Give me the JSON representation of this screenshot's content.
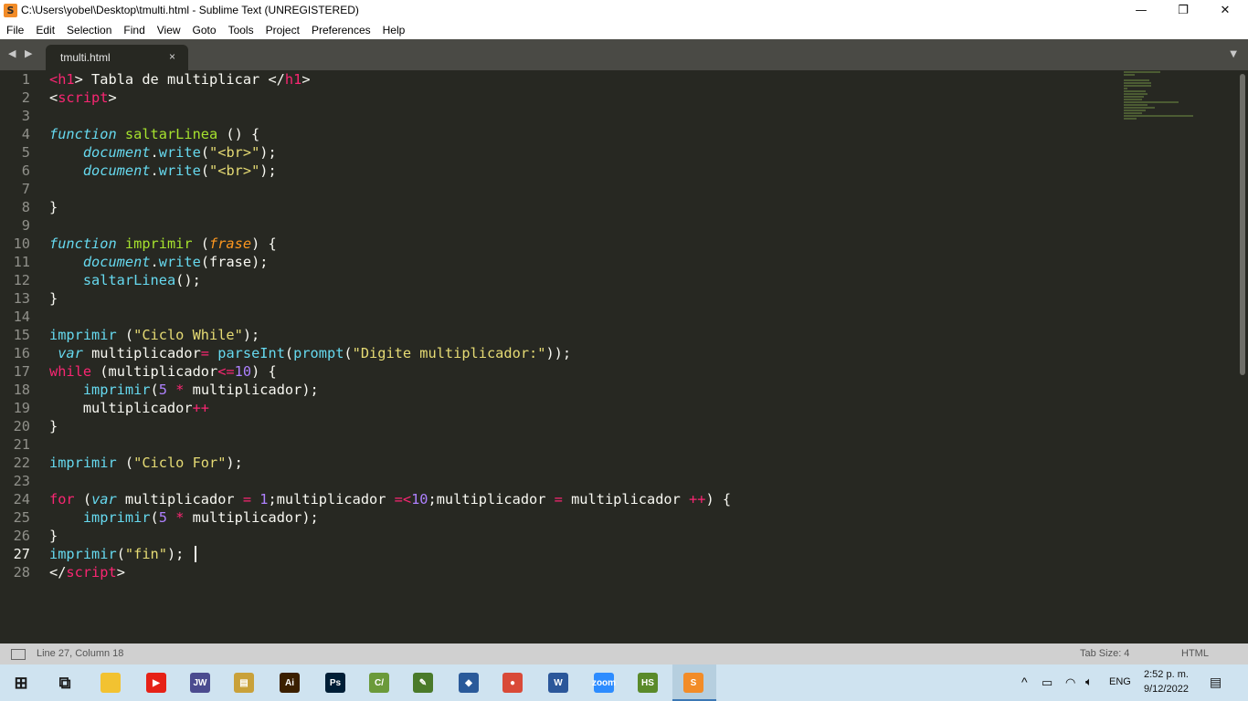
{
  "window": {
    "title": "C:\\Users\\yobel\\Desktop\\tmulti.html - Sublime Text (UNREGISTERED)",
    "app_icon": "S",
    "controls": {
      "minimize": "—",
      "maximize": "❐",
      "close": "✕"
    }
  },
  "menu": [
    "File",
    "Edit",
    "Selection",
    "Find",
    "View",
    "Goto",
    "Tools",
    "Project",
    "Preferences",
    "Help"
  ],
  "tabs": {
    "nav_arrows": "◀ ▶",
    "active": {
      "label": "tmulti.html",
      "close": "×"
    },
    "dropdown": "▼"
  },
  "editor": {
    "line_numbers": [
      "1",
      "2",
      "3",
      "4",
      "5",
      "6",
      "7",
      "8",
      "9",
      "10",
      "11",
      "12",
      "13",
      "14",
      "15",
      "16",
      "17",
      "18",
      "19",
      "20",
      "21",
      "22",
      "23",
      "24",
      "25",
      "26",
      "27",
      "28"
    ],
    "active_line": 27
  },
  "status": {
    "position": "Line 27, Column 18",
    "tab_size": "Tab Size: 4",
    "syntax": "HTML"
  },
  "taskbar": {
    "apps": [
      {
        "name": "start-icon",
        "glyph": "⊞",
        "color": "#1a1a1a"
      },
      {
        "name": "task-view-icon",
        "glyph": "⧉",
        "color": "#1a1a1a"
      },
      {
        "name": "file-explorer-icon",
        "glyph": "",
        "color": "#f2c231"
      },
      {
        "name": "youtube-icon",
        "glyph": "▶",
        "color": "#e62117"
      },
      {
        "name": "jw-icon",
        "glyph": "JW",
        "color": "#4b4b8f"
      },
      {
        "name": "certificate-icon",
        "glyph": "▤",
        "color": "#c9a13a"
      },
      {
        "name": "illustrator-icon",
        "glyph": "Ai",
        "color": "#3b1f00"
      },
      {
        "name": "photoshop-icon",
        "glyph": "Ps",
        "color": "#001e36"
      },
      {
        "name": "cpp-icon",
        "glyph": "C/",
        "color": "#6b9a3a"
      },
      {
        "name": "tool-icon",
        "glyph": "✎",
        "color": "#4a7a2a"
      },
      {
        "name": "virtualbox-icon",
        "glyph": "◆",
        "color": "#2a5a9a"
      },
      {
        "name": "chrome-icon",
        "glyph": "●",
        "color": "#d94a38"
      },
      {
        "name": "word-icon",
        "glyph": "W",
        "color": "#2b579a"
      },
      {
        "name": "zoom-icon",
        "glyph": "zoom",
        "color": "#2d8cff"
      },
      {
        "name": "hs-icon",
        "glyph": "HS",
        "color": "#5a8a2a"
      },
      {
        "name": "sublime-icon",
        "glyph": "S",
        "color": "#f28c28"
      }
    ],
    "tray": {
      "chevron": "^",
      "language": "ENG",
      "time": "2:52 p. m.",
      "date": "9/12/2022"
    }
  }
}
